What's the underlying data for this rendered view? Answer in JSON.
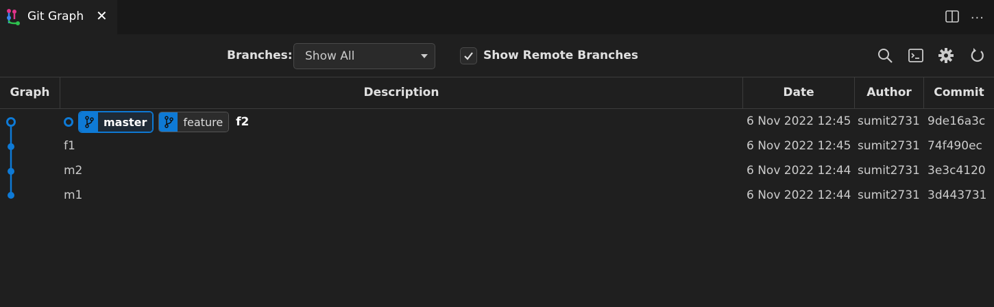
{
  "tab": {
    "title": "Git Graph",
    "close_label": "✕"
  },
  "editor_actions": {
    "split_icon": "split-editor-icon",
    "more_icon": "more-actions-icon",
    "more_label": "···"
  },
  "controls": {
    "branches_label": "Branches:",
    "branches_value": "Show All",
    "show_remote_label": "Show Remote Branches",
    "show_remote_checked": true,
    "icons": [
      "search-icon",
      "terminal-icon",
      "gear-icon",
      "refresh-icon"
    ]
  },
  "table": {
    "headers": {
      "graph": "Graph",
      "description": "Description",
      "date": "Date",
      "author": "Author",
      "commit": "Commit"
    },
    "rows": [
      {
        "description": "f2",
        "branches": [
          "master",
          "feature"
        ],
        "date": "6 Nov 2022 12:45",
        "author": "sumit2731",
        "commit": "9de16a3c"
      },
      {
        "description": "f1",
        "date": "6 Nov 2022 12:45",
        "author": "sumit2731",
        "commit": "74f490ec"
      },
      {
        "description": "m2",
        "date": "6 Nov 2022 12:44",
        "author": "sumit2731",
        "commit": "3e3c4120"
      },
      {
        "description": "m1",
        "date": "6 Nov 2022 12:44",
        "author": "sumit2731",
        "commit": "3d443731"
      }
    ]
  },
  "colors": {
    "accent": "#0e7ad6",
    "background": "#1f1f1f",
    "tabbar": "#181818"
  }
}
